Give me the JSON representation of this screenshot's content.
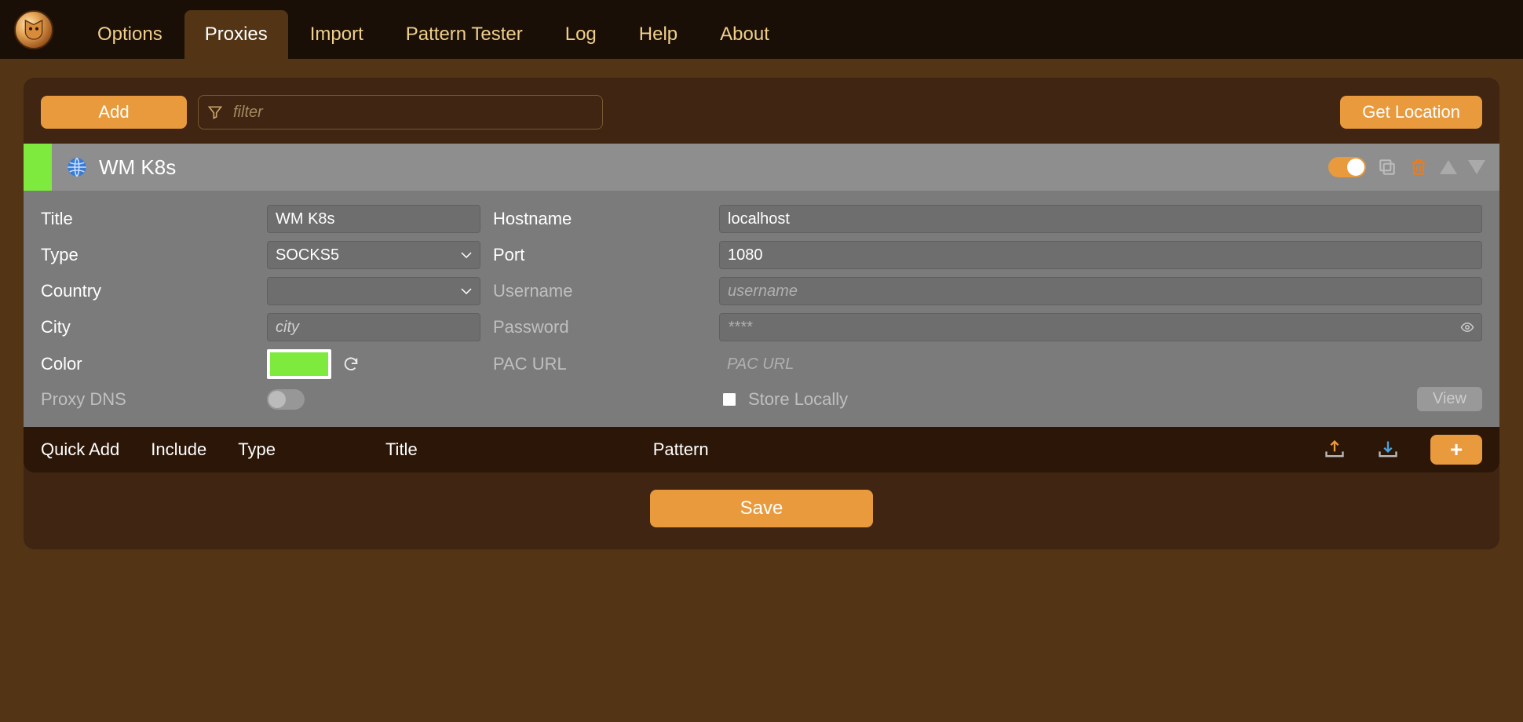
{
  "tabs": {
    "options": "Options",
    "proxies": "Proxies",
    "import": "Import",
    "pattern_tester": "Pattern Tester",
    "log": "Log",
    "help": "Help",
    "about": "About"
  },
  "toolbar": {
    "add_label": "Add",
    "filter_placeholder": "filter",
    "get_location_label": "Get Location"
  },
  "proxy": {
    "header_title": "WM K8s",
    "color_strip": "#7dea3d",
    "enabled": true,
    "fields": {
      "title_label": "Title",
      "title_value": "WM K8s",
      "type_label": "Type",
      "type_value": "SOCKS5",
      "country_label": "Country",
      "country_value": "",
      "city_label": "City",
      "city_value": "",
      "city_placeholder": "city",
      "color_label": "Color",
      "proxy_dns_label": "Proxy DNS",
      "hostname_label": "Hostname",
      "hostname_value": "localhost",
      "port_label": "Port",
      "port_value": "1080",
      "username_label": "Username",
      "username_value": "",
      "username_placeholder": "username",
      "password_label": "Password",
      "password_value": "",
      "password_placeholder": "****",
      "pacurl_label": "PAC URL",
      "pacurl_value": "",
      "pacurl_placeholder": "PAC URL",
      "store_locally_label": "Store Locally",
      "view_label": "View"
    }
  },
  "quickbar": {
    "quick_add": "Quick Add",
    "include": "Include",
    "type": "Type",
    "title": "Title",
    "pattern": "Pattern"
  },
  "footer": {
    "save_label": "Save"
  }
}
